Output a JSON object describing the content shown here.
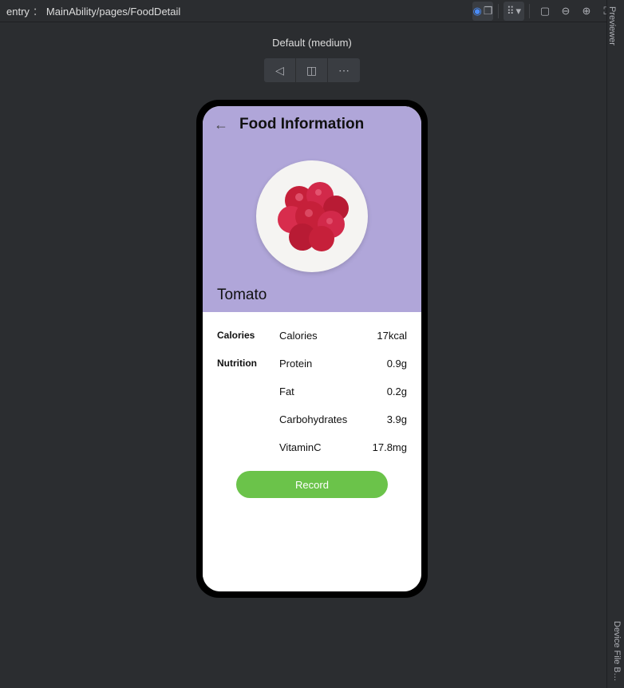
{
  "ide": {
    "path_prefix": "entry",
    "path_sep": "：",
    "path": "MainAbility/pages/FoodDetail",
    "device_label": "Default (medium)",
    "right_tab_label": "Previewer",
    "right_tab_label2": "Device File B…"
  },
  "app": {
    "title": "Food Information",
    "food_name": "Tomato",
    "record_label": "Record",
    "section_cal": "Calories",
    "section_nut": "Nutrition",
    "rows": [
      {
        "label": "Calories",
        "value": "17kcal"
      },
      {
        "label": "Protein",
        "value": "0.9g"
      },
      {
        "label": "Fat",
        "value": "0.2g"
      },
      {
        "label": "Carbohydrates",
        "value": "3.9g"
      },
      {
        "label": "VitaminC",
        "value": "17.8mg"
      }
    ]
  }
}
